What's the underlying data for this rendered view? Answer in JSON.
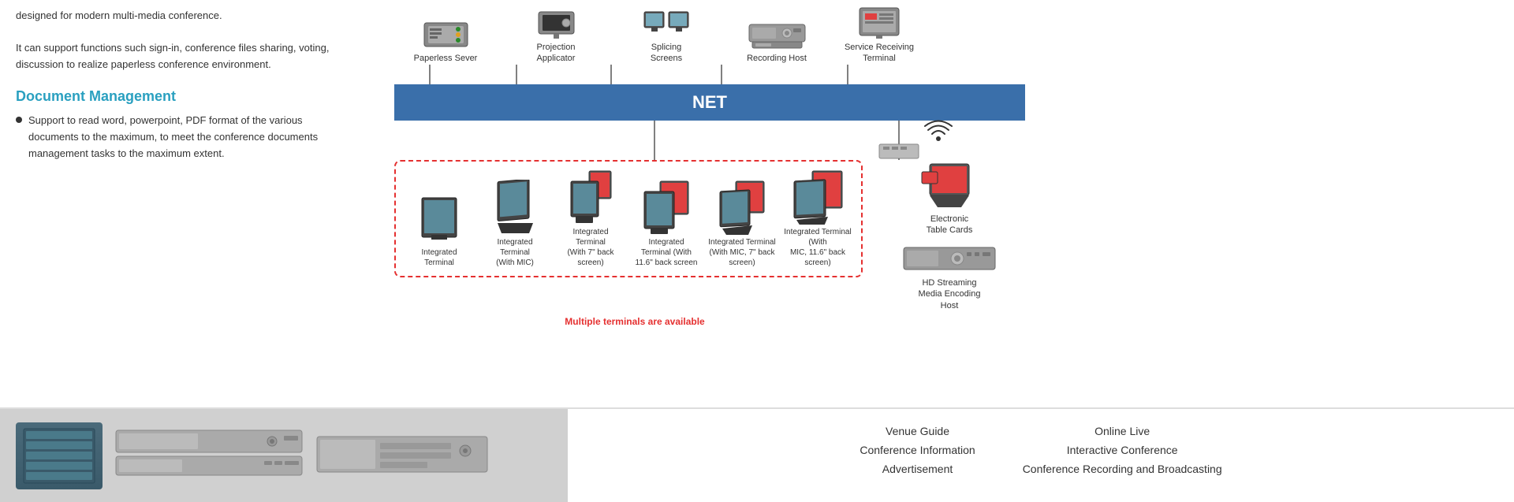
{
  "left": {
    "intro_text": "designed for modern multi-media conference.",
    "intro_text2": "It can support functions such sign-in, conference files sharing, voting, discussion to realize paperless conference environment.",
    "doc_management_title": "Document Management",
    "bullet1": "Support to read word, powerpoint, PDF format of the various documents to the maximum, to meet the conference documents management tasks to the maximum extent."
  },
  "diagram": {
    "net_label": "NET",
    "top_devices": [
      {
        "label": "Paperless Sever",
        "type": "server"
      },
      {
        "label": "Projection\nApplicator",
        "type": "projector"
      },
      {
        "label": "Splicing\nScreens",
        "type": "screens"
      },
      {
        "label": "Recording Host",
        "type": "recording"
      },
      {
        "label": "Service Receiving\nTerminal",
        "type": "service"
      }
    ],
    "terminals": [
      {
        "label": "Integrated\nTerminal",
        "type": "flat"
      },
      {
        "label": "Integrated\nTerminal\n(With MIC)",
        "type": "angled"
      },
      {
        "label": "Integrated\nTerminal\n(With 7\" back\nscreen)",
        "type": "kiosk"
      },
      {
        "label": "Integrated\nTerminal (With\n11.6\" back screen",
        "type": "kiosk2"
      },
      {
        "label": "Integrated Terminal\n(With MIC, 7\" back\nscreen)",
        "type": "kiosk3"
      },
      {
        "label": "Integrated Terminal (With\nMIC, 11.6\" back screen)",
        "type": "kiosk4"
      }
    ],
    "multiple_terminals_text": "Multiple terminals are\navailable",
    "right_devices": [
      {
        "label": "Electronic\nTable Cards",
        "type": "table_card"
      },
      {
        "label": "HD Streaming\nMedia Encoding\nHost",
        "type": "streaming"
      }
    ]
  },
  "bottom": {
    "left_items": [],
    "col1": [
      "Venue Guide",
      "Conference Information",
      "Advertisement"
    ],
    "col2": [
      "Online Live",
      "Interactive Conference",
      "Conference Recording and Broadcasting"
    ]
  }
}
